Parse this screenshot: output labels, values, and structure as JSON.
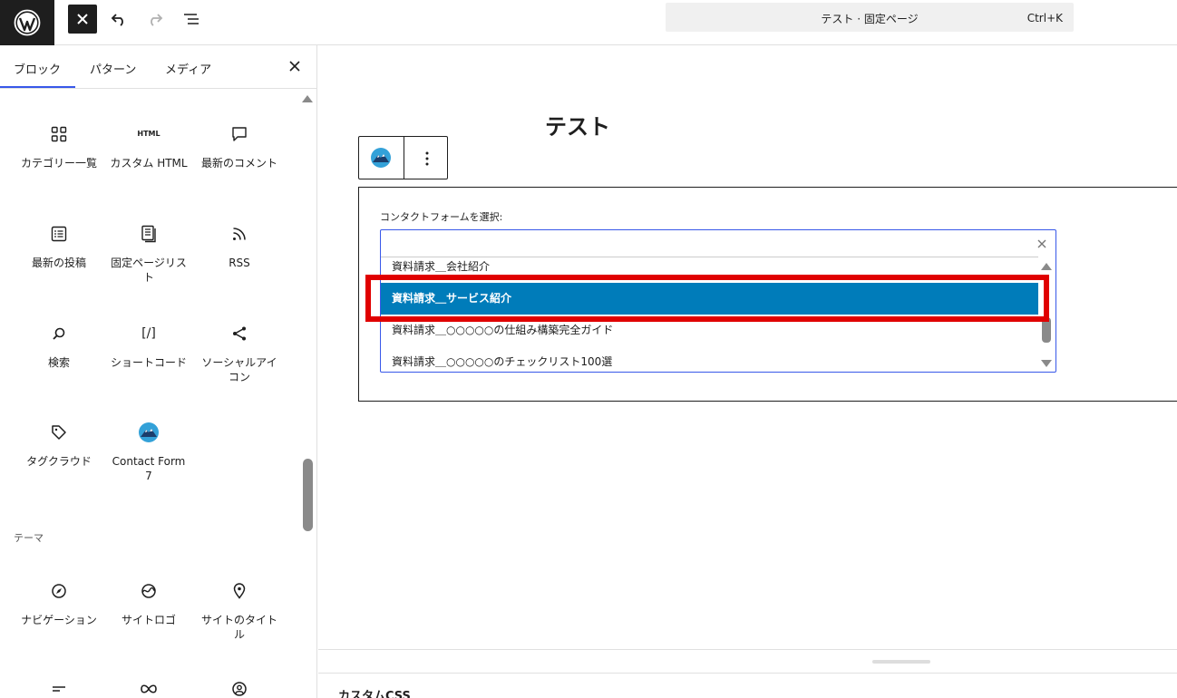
{
  "header": {
    "document_title": "テスト · 固定ページ",
    "shortcut": "Ctrl+K"
  },
  "sidebar": {
    "tabs": [
      {
        "label": "ブロック",
        "active": true
      },
      {
        "label": "パターン",
        "active": false
      },
      {
        "label": "メディア",
        "active": false
      }
    ],
    "blocks": [
      {
        "label": "カテゴリー一覧",
        "icon": "grid-icon"
      },
      {
        "label": "カスタム HTML",
        "icon": "html-icon",
        "icon_text": "HTML"
      },
      {
        "label": "最新のコメント",
        "icon": "comment-icon"
      },
      {
        "label": "最新の投稿",
        "icon": "post-list-icon"
      },
      {
        "label": "固定ページリスト",
        "icon": "page-list-icon"
      },
      {
        "label": "RSS",
        "icon": "rss-icon"
      },
      {
        "label": "検索",
        "icon": "search-icon"
      },
      {
        "label": "ショートコード",
        "icon": "shortcode-icon",
        "icon_text": "[/]"
      },
      {
        "label": "ソーシャルアイコン",
        "icon": "share-icon"
      },
      {
        "label": "タグクラウド",
        "icon": "tag-icon"
      },
      {
        "label": "Contact Form 7",
        "icon": "contact-form-7-icon"
      }
    ],
    "theme_section": "テーマ",
    "theme_blocks": [
      {
        "label": "ナビゲーション",
        "icon": "compass-icon"
      },
      {
        "label": "サイトロゴ",
        "icon": "site-logo-icon"
      },
      {
        "label": "サイトのタイトル",
        "icon": "map-pin-icon"
      }
    ]
  },
  "editor": {
    "page_title": "テスト",
    "cf7": {
      "label": "コンタクトフォームを選択:",
      "search_value": "",
      "options": [
        {
          "label": "資料請求＿会社紹介",
          "selected": false
        },
        {
          "label": "資料請求＿サービス紹介",
          "selected": true
        },
        {
          "label": "資料請求＿○○○○○の仕組み構築完全ガイド",
          "selected": false
        },
        {
          "label": "資料請求＿○○○○○のチェックリスト100選",
          "selected": false
        }
      ]
    }
  },
  "meta": {
    "custom_css_title": "カスタムCSS"
  },
  "colors": {
    "accent": "#3858e9",
    "selection": "#007cba",
    "highlight": "#e00000"
  }
}
